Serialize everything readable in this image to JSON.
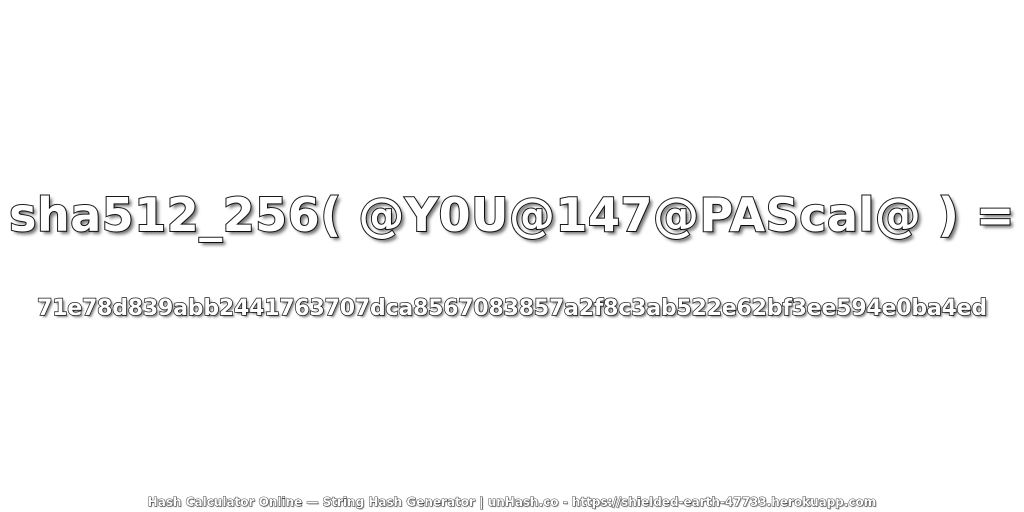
{
  "expression": "sha512_256( @Y0U@147@PAScal@ ) =",
  "hash_value": "71e78d839abb2441763707dca8567083857a2f8c3ab522e62bf3ee594e0ba4ed",
  "footer": "Hash Calculator Online — String Hash Generator | unHash.co - https://shielded-earth-47733.herokuapp.com",
  "colors": {
    "background": "#ffffff",
    "text_fill": "#ffffff",
    "text_outline": "#1a1a1a"
  }
}
